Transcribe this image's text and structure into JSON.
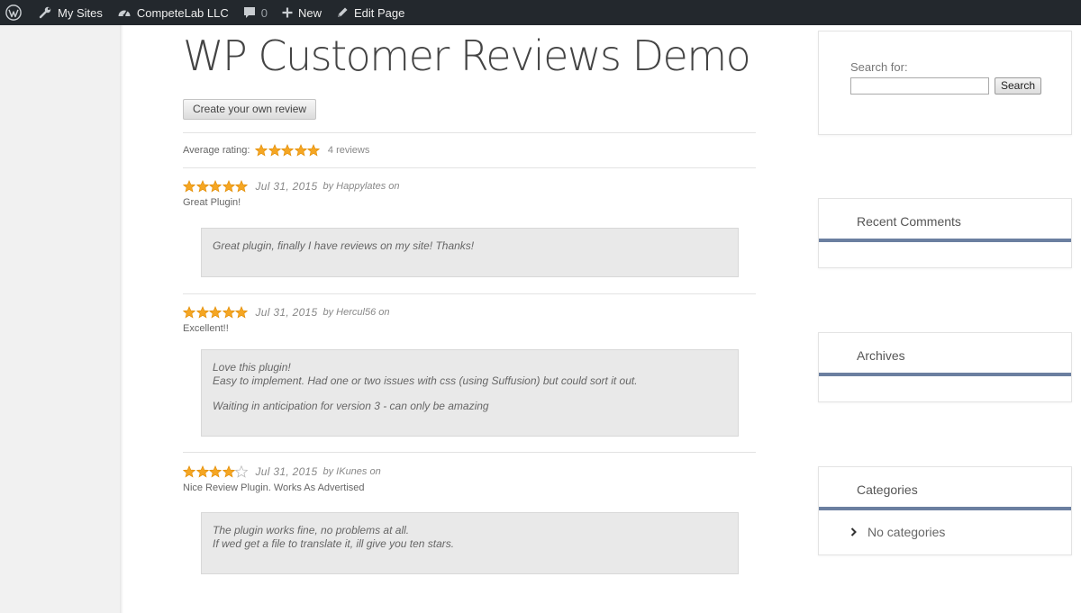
{
  "adminbar": {
    "my_sites": "My Sites",
    "site_name": "CompeteLab LLC",
    "comments_count": "0",
    "new_label": "New",
    "edit_page": "Edit Page"
  },
  "page": {
    "title": "WP Customer Reviews Demo",
    "create_review_button": "Create your own review",
    "average_label": "Average rating:",
    "average_stars": 5,
    "reviews_count": "4 reviews"
  },
  "reviews": [
    {
      "stars": 5,
      "date": "Jul 31, 2015",
      "author": "by Happylates on",
      "title": "Great Plugin!",
      "body": [
        "Great plugin, finally I have reviews on my site! Thanks!"
      ]
    },
    {
      "stars": 5,
      "date": "Jul 31, 2015",
      "author": "by Hercul56 on",
      "title": "Excellent!!",
      "body": [
        "Love this plugin!",
        "Easy to implement. Had one or two issues with css (using Suffusion) but could sort it out.",
        "",
        "Waiting in anticipation for version 3 - can only be amazing"
      ]
    },
    {
      "stars": 4,
      "date": "Jul 31, 2015",
      "author": "by IKunes on",
      "title": "Nice Review Plugin. Works As Advertised",
      "body": [
        "The plugin works fine, no problems at all.",
        "If wed get a file to translate it, ill give you ten stars."
      ]
    }
  ],
  "sidebar": {
    "search_label": "Search for:",
    "search_value": "",
    "search_button": "Search",
    "recent_comments_title": "Recent Comments",
    "archives_title": "Archives",
    "categories_title": "Categories",
    "no_categories": "No categories"
  },
  "colors": {
    "star": "#f5a623",
    "widget_accent": "#6b7fa0",
    "adminbar": "#23282d"
  }
}
